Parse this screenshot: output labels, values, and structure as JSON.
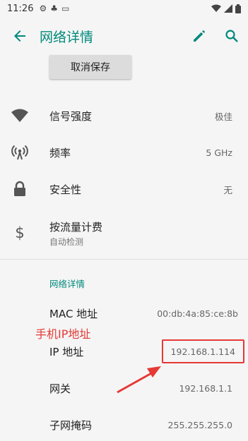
{
  "status_bar": {
    "time": "11:26",
    "icons": [
      "gear-icon",
      "clover-icon",
      "monitor-icon"
    ],
    "right_icons": [
      "wifi-icon",
      "signal-icon",
      "battery-icon"
    ]
  },
  "app_bar": {
    "title": "网络详情",
    "icons": [
      "back-arrow-icon",
      "edit-pencil-icon",
      "search-icon"
    ]
  },
  "cancel_button": "取消保存",
  "rows": [
    {
      "icon": "wifi-signal-icon",
      "label": "信号强度",
      "value": "极佳"
    },
    {
      "icon": "antenna-icon",
      "label": "频率",
      "value": "5 GHz"
    },
    {
      "icon": "lock-icon",
      "label": "安全性",
      "value": "无"
    },
    {
      "icon": "dollar-icon",
      "label": "按流量计费",
      "sub": "自动检测"
    }
  ],
  "section_header": "网络详情",
  "details": [
    {
      "label": "MAC 地址",
      "value": "00:db:4a:85:ce:8b"
    },
    {
      "label": "IP 地址",
      "value": "192.168.1.114"
    },
    {
      "label": "网关",
      "value": "192.168.1.1"
    },
    {
      "label": "子网掩码",
      "value": "255.255.255.0"
    }
  ],
  "annotation": "手机IP地址",
  "colors": {
    "accent": "#00897b",
    "annotation": "#e53935",
    "background": "#f5f5f5"
  }
}
